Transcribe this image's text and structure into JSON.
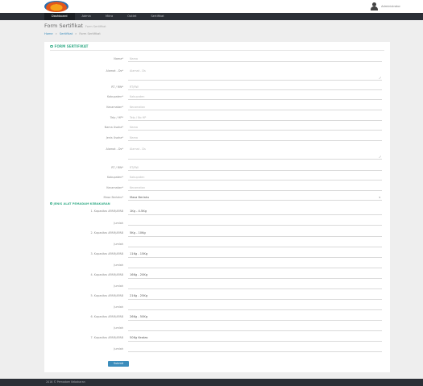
{
  "user": {
    "name": "Administrator"
  },
  "nav": [
    {
      "label": "Dashboard"
    },
    {
      "label": "Admin"
    },
    {
      "label": "Mitra"
    },
    {
      "label": "Outlet"
    },
    {
      "label": "Sertifikat"
    }
  ],
  "page": {
    "title": "Form Sertifikat",
    "subtitle": "Form Sertifikat"
  },
  "breadcrumb": {
    "home": "Home",
    "sep1": "»",
    "section": "Sertifikat",
    "sep2": "»",
    "current": "Form Sertifikat"
  },
  "form": {
    "heading": "FORM SERTIFIKAT",
    "fields": {
      "nama": {
        "label": "Nama*",
        "placeholder": "Nama"
      },
      "alamat": {
        "label": "Alamat - Ds*",
        "placeholder": "Alamat - Ds"
      },
      "rt_rw": {
        "label": "RT / RW*",
        "placeholder": "RT/RW"
      },
      "kabupaten": {
        "label": "Kabupaten*",
        "placeholder": "Kabupaten"
      },
      "kecamatan": {
        "label": "Kecamatan*",
        "placeholder": "Kecamatan"
      },
      "telp": {
        "label": "Telp / HP*",
        "placeholder": "Telp / No HP"
      },
      "nama_usaha": {
        "label": "Nama Usaha*",
        "placeholder": "Nama"
      },
      "jenis_usaha": {
        "label": "Jenis Usaha*",
        "placeholder": "Nama"
      },
      "alamat_usaha": {
        "label": "Alamat - Ds*",
        "placeholder": "Alamat - Ds"
      },
      "rt_rw_usaha": {
        "label": "RT / RW*",
        "placeholder": "RT/RW"
      },
      "kabupaten_usaha": {
        "label": "Kabupaten*",
        "placeholder": "Kabupaten"
      },
      "kecamatan_usaha": {
        "label": "Kecamatan*",
        "placeholder": "Kecamatan"
      },
      "masa_berlaku": {
        "label": "Masa Berlaku*",
        "value": "Masa Berlaku"
      }
    },
    "section_heading": "JENIS ALAT PEMADAM KEBAKARAN",
    "apar": [
      {
        "label": "1. Kapasitas APAR/APAB",
        "value": "1Kg - 4.5Kg",
        "jumlah_label": "Jumlah"
      },
      {
        "label": "2. Kapasitas APAR/APAB",
        "value": "5Kg - 10Kg",
        "jumlah_label": "Jumlah"
      },
      {
        "label": "3. Kapasitas APAR/APAB",
        "value": "11Kg - 15Kg",
        "jumlah_label": "Jumlah"
      },
      {
        "label": "4. Kapasitas APAR/APAB",
        "value": "16Kg - 20Kg",
        "jumlah_label": "Jumlah"
      },
      {
        "label": "5. Kapasitas APAR/APAB",
        "value": "21Kg - 25Kg",
        "jumlah_label": "Jumlah"
      },
      {
        "label": "6. Kapasitas APAR/APAB",
        "value": "26Kg - 50Kg",
        "jumlah_label": "Jumlah"
      },
      {
        "label": "7. Kapasitas APAR/APAB",
        "value": "50Kg Keatas",
        "jumlah_label": "Jumlah"
      }
    ],
    "submit_label": "Submit"
  },
  "footer": {
    "text": "2016 © Pemadam Kebakaran"
  },
  "colors": {
    "accent": "#3fb08e",
    "primary": "#3c8dbc",
    "navbar": "#2b2f36"
  }
}
